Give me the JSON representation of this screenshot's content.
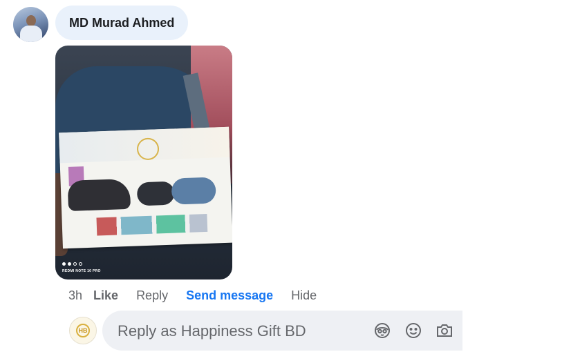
{
  "comment": {
    "author_name": "MD Murad Ahmed",
    "attachment_watermark": "REDMI NOTE 10 PRO",
    "attachment_dots": [
      true,
      true,
      false,
      false
    ]
  },
  "actions": {
    "time": "3h",
    "like": "Like",
    "reply": "Reply",
    "send_message": "Send message",
    "hide": "Hide"
  },
  "reply_box": {
    "placeholder": "Reply as Happiness Gift BD",
    "page_avatar_mark": "HB",
    "icons": [
      "avatar-sticker-icon",
      "emoji-icon",
      "camera-icon"
    ]
  },
  "colors": {
    "link_blue": "#1877f2",
    "secondary_text": "#65676b",
    "name_bubble_bg": "#e9f1fb",
    "input_bg": "#eef0f4"
  }
}
